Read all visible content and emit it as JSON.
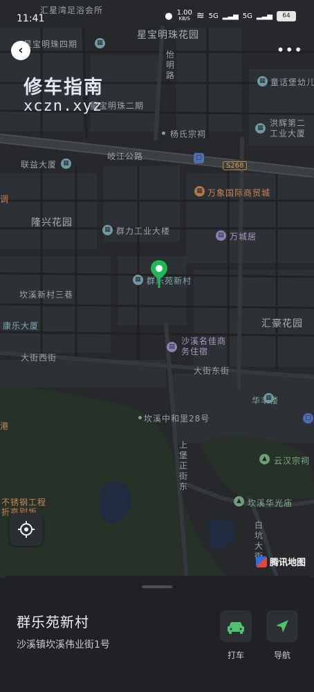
{
  "status_bar": {
    "time": "11:41",
    "net_speed": "1.00",
    "net_unit": "KB/S",
    "sig1": "5G",
    "sig2": "5G",
    "battery": "64"
  },
  "watermark": {
    "line1": "修车指南",
    "line2": "xczn.xyz"
  },
  "map": {
    "labels": {
      "top_left": "汇星湾足浴会所",
      "xingbao4": "星宝明珠四期",
      "xingbao_garden": "星宝明珠花园",
      "yiming": "怡明路",
      "xingbao2": "星宝明珠二期",
      "yangshi": "杨氏宗祠",
      "tonghua": "童话堡幼儿",
      "hongli": "洪辉第二工业大厦",
      "qijiang": "岐江公路",
      "s268": "S268",
      "lianyi": "联益大厦",
      "wanxiang": "万象国际商贸城",
      "diao": "调",
      "longxing": "隆兴花园",
      "qunli": "群力工业大楼",
      "wancheng": "万城居",
      "qunle_map": "群乐苑新村",
      "kanxi3": "坎溪新村三巷",
      "kangle": "康乐大厦",
      "huihao": "汇豪花园",
      "dajie_west": "大街西街",
      "shaxi_hotel": "沙溪名佳商务住宿",
      "dajie_east": "大街东街",
      "huafeng": "华丰楼",
      "gang": "港",
      "kanxi28": "坎溪中和里28号",
      "shangbao": "上堡正街东",
      "yunhan": "云汉宗祠",
      "budiao": "不锈钢工程",
      "zhejing": "折亮别坂",
      "kanxi_hua": "坎溪华光庙",
      "baikeng": "白坑大街"
    },
    "provider": "腾讯地图"
  },
  "place": {
    "name": "群乐苑新村",
    "address": "沙溪镇坎溪伟业街1号"
  },
  "actions": [
    {
      "label": "打车",
      "icon": "car-icon"
    },
    {
      "label": "导航",
      "icon": "navigate-icon"
    }
  ],
  "colors": {
    "pin": "#1db954",
    "accent_green": "#4fc36d",
    "background": "#1f2124"
  }
}
